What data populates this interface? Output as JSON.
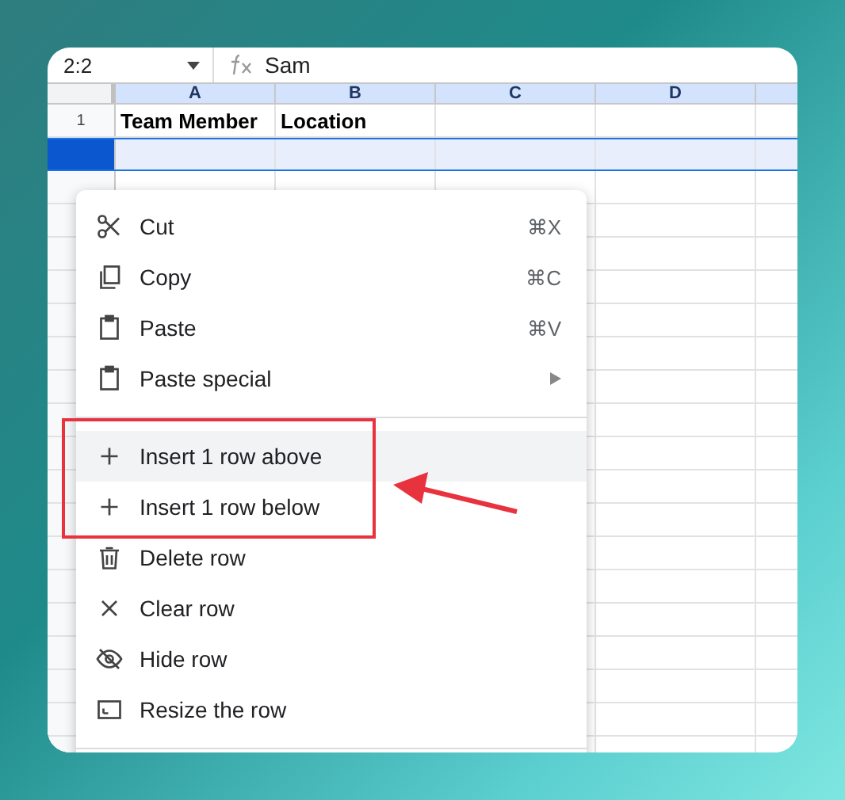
{
  "formula_bar": {
    "cell_ref": "2:2",
    "formula": "Sam"
  },
  "columns": [
    "A",
    "B",
    "C",
    "D"
  ],
  "rows": [
    {
      "number": "1",
      "selected": false,
      "cells": [
        "Team Member",
        "Location"
      ]
    },
    {
      "selected": true,
      "cells": []
    }
  ],
  "menu": {
    "groups": [
      [
        {
          "label": "Cut",
          "shortcut": "⌘X",
          "submenu": false,
          "selected": false
        },
        {
          "label": "Copy",
          "shortcut": "⌘C",
          "submenu": false,
          "selected": false
        },
        {
          "label": "Paste",
          "shortcut": "⌘V",
          "submenu": false,
          "selected": false
        },
        {
          "label": "Paste special",
          "submenu": true,
          "selected": false
        }
      ],
      [
        {
          "label": "Insert 1 row above",
          "submenu": false,
          "selected": true
        },
        {
          "label": "Insert 1 row below",
          "submenu": false,
          "selected": false
        },
        {
          "label": "Delete row",
          "submenu": false,
          "selected": false
        },
        {
          "label": "Clear row",
          "submenu": false,
          "selected": false
        },
        {
          "label": "Hide row",
          "submenu": false,
          "selected": false
        },
        {
          "label": "Resize the row",
          "submenu": false,
          "selected": false
        }
      ]
    ]
  }
}
